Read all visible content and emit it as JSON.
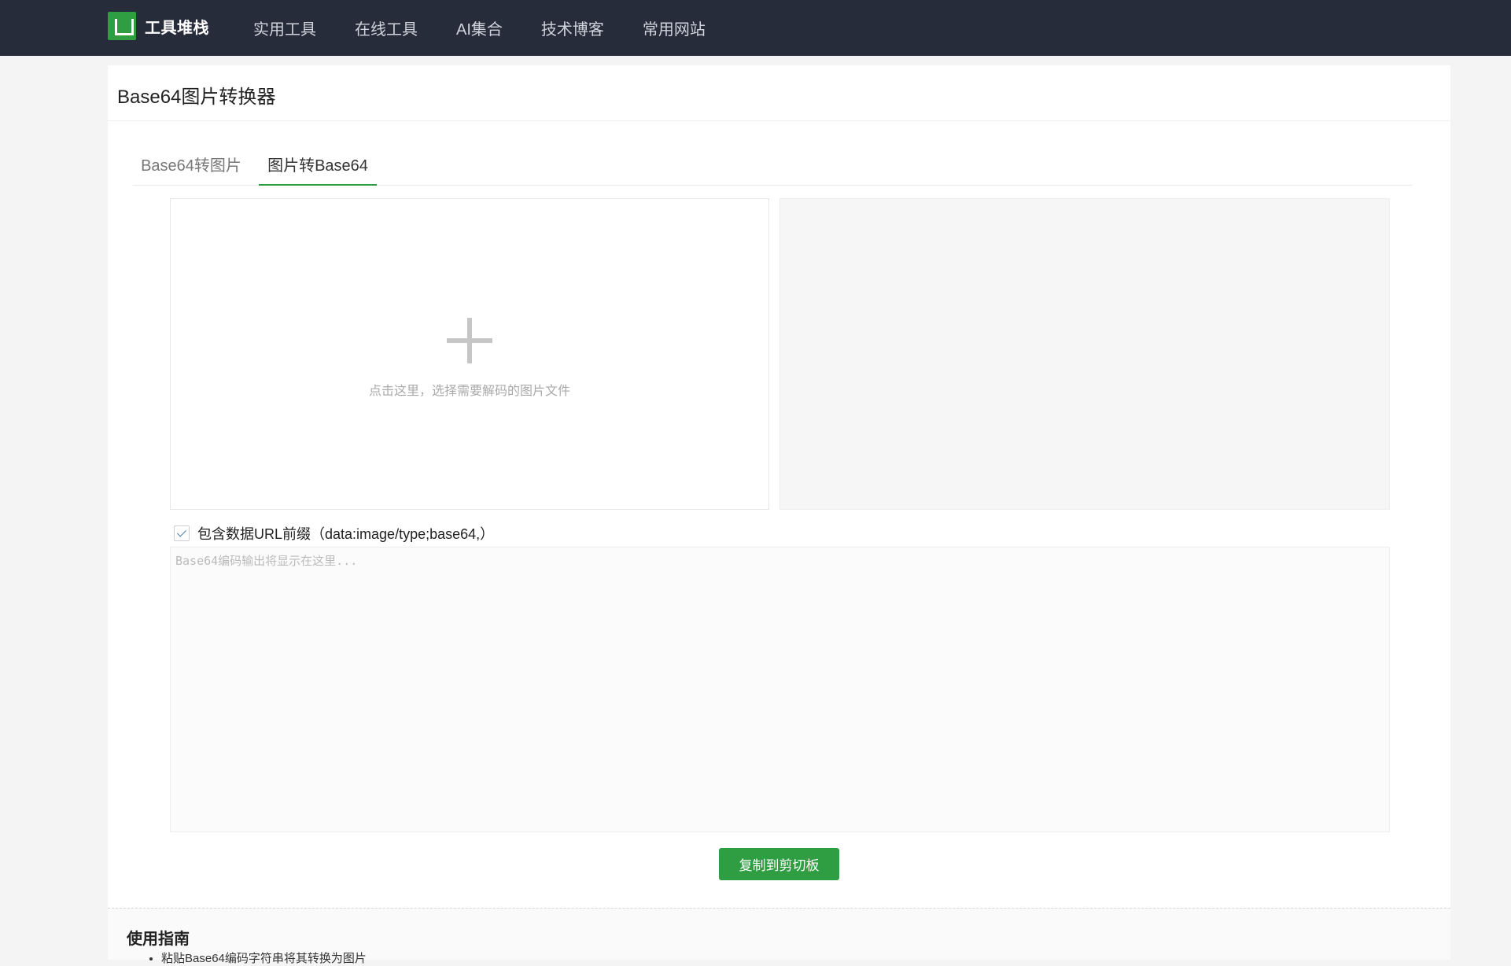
{
  "nav": {
    "brand_name": "工具堆栈",
    "items": [
      "实用工具",
      "在线工具",
      "AI集合",
      "技术博客",
      "常用网站"
    ]
  },
  "page": {
    "title": "Base64图片转换器"
  },
  "tabs": [
    {
      "label": "Base64转图片",
      "active": false
    },
    {
      "label": "图片转Base64",
      "active": true
    }
  ],
  "upload": {
    "hint": "点击这里，选择需要解码的图片文件"
  },
  "options": {
    "include_prefix_label": "包含数据URL前缀（data:image/type;base64,）",
    "include_prefix_checked": true
  },
  "output": {
    "placeholder": "Base64编码输出将显示在这里...",
    "value": ""
  },
  "actions": {
    "copy_label": "复制到剪切板"
  },
  "guide": {
    "title": "使用指南",
    "items": [
      "粘贴Base64编码字符串将其转换为图片"
    ]
  },
  "colors": {
    "topbar": "#272c3b",
    "accent": "#2f9e42"
  }
}
